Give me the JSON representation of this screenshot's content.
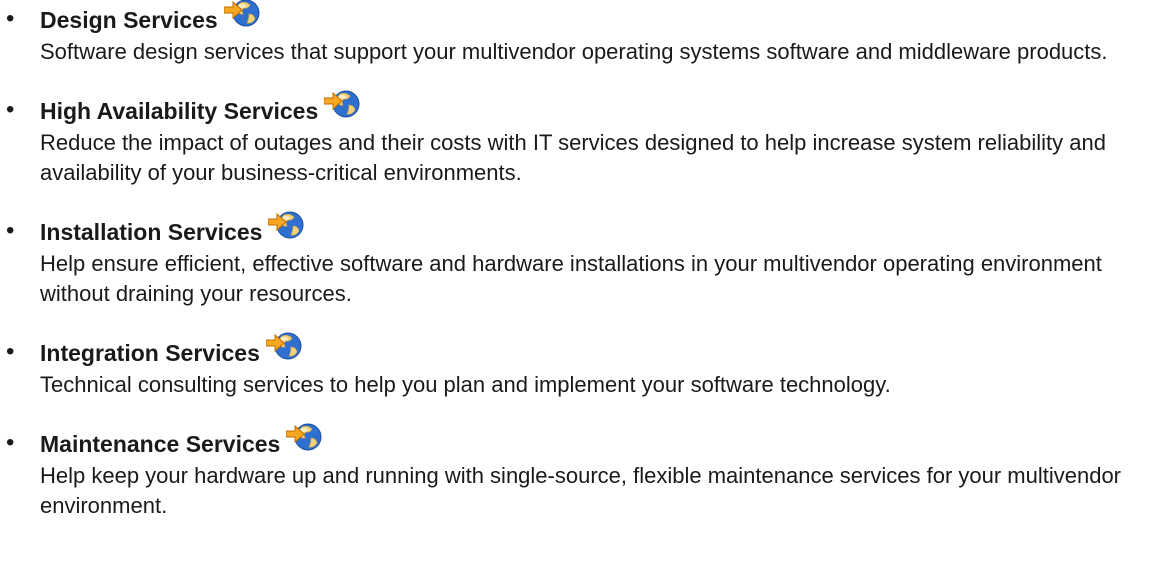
{
  "services": [
    {
      "title": "Design Services",
      "description": "Software design services that support your multivendor operating systems software and middleware products.",
      "icon": "external-link-globe-icon"
    },
    {
      "title": "High Availability Services",
      "description": "Reduce the impact of outages and their costs with IT services designed to help increase system reliability and availability of your business-critical environments.",
      "icon": "external-link-globe-icon"
    },
    {
      "title": "Installation Services",
      "description": "Help ensure efficient, effective software and hardware installations in your multivendor operating environment without draining your resources.",
      "icon": "external-link-globe-icon"
    },
    {
      "title": "Integration Services",
      "description": "Technical consulting services to help you plan and implement your software technology.",
      "icon": "external-link-globe-icon"
    },
    {
      "title": "Maintenance Services",
      "description": "Help keep your hardware up and running with single-source, flexible maintenance services for your multivendor environment.",
      "icon": "external-link-globe-icon"
    }
  ],
  "colors": {
    "text": "#1a1a1a",
    "arrow": "#f7a823",
    "globe_ocean": "#2f6fd0",
    "globe_land": "#f2d27a"
  }
}
